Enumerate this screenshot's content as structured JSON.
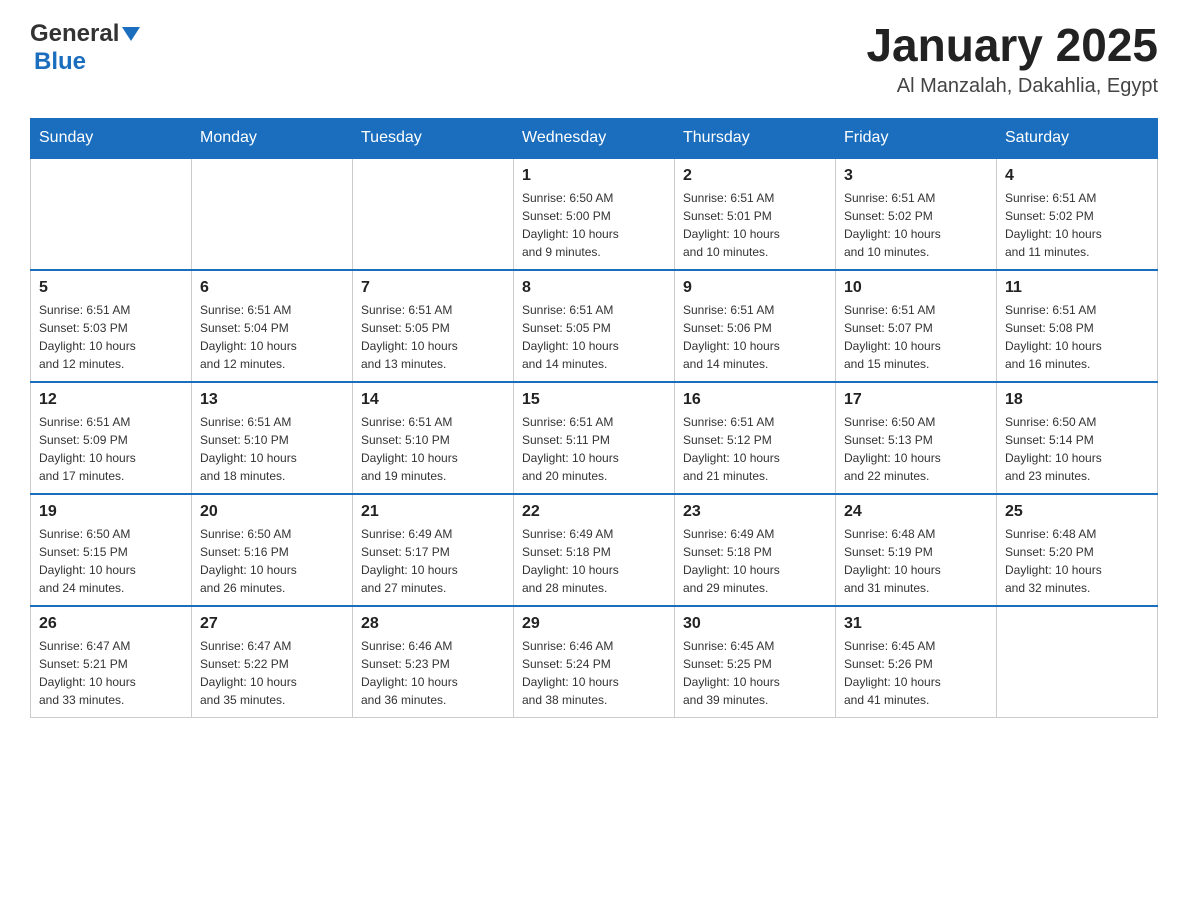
{
  "header": {
    "logo_general": "General",
    "logo_blue": "Blue",
    "title": "January 2025",
    "subtitle": "Al Manzalah, Dakahlia, Egypt"
  },
  "days_of_week": [
    "Sunday",
    "Monday",
    "Tuesday",
    "Wednesday",
    "Thursday",
    "Friday",
    "Saturday"
  ],
  "weeks": [
    [
      {
        "num": "",
        "info": ""
      },
      {
        "num": "",
        "info": ""
      },
      {
        "num": "",
        "info": ""
      },
      {
        "num": "1",
        "info": "Sunrise: 6:50 AM\nSunset: 5:00 PM\nDaylight: 10 hours\nand 9 minutes."
      },
      {
        "num": "2",
        "info": "Sunrise: 6:51 AM\nSunset: 5:01 PM\nDaylight: 10 hours\nand 10 minutes."
      },
      {
        "num": "3",
        "info": "Sunrise: 6:51 AM\nSunset: 5:02 PM\nDaylight: 10 hours\nand 10 minutes."
      },
      {
        "num": "4",
        "info": "Sunrise: 6:51 AM\nSunset: 5:02 PM\nDaylight: 10 hours\nand 11 minutes."
      }
    ],
    [
      {
        "num": "5",
        "info": "Sunrise: 6:51 AM\nSunset: 5:03 PM\nDaylight: 10 hours\nand 12 minutes."
      },
      {
        "num": "6",
        "info": "Sunrise: 6:51 AM\nSunset: 5:04 PM\nDaylight: 10 hours\nand 12 minutes."
      },
      {
        "num": "7",
        "info": "Sunrise: 6:51 AM\nSunset: 5:05 PM\nDaylight: 10 hours\nand 13 minutes."
      },
      {
        "num": "8",
        "info": "Sunrise: 6:51 AM\nSunset: 5:05 PM\nDaylight: 10 hours\nand 14 minutes."
      },
      {
        "num": "9",
        "info": "Sunrise: 6:51 AM\nSunset: 5:06 PM\nDaylight: 10 hours\nand 14 minutes."
      },
      {
        "num": "10",
        "info": "Sunrise: 6:51 AM\nSunset: 5:07 PM\nDaylight: 10 hours\nand 15 minutes."
      },
      {
        "num": "11",
        "info": "Sunrise: 6:51 AM\nSunset: 5:08 PM\nDaylight: 10 hours\nand 16 minutes."
      }
    ],
    [
      {
        "num": "12",
        "info": "Sunrise: 6:51 AM\nSunset: 5:09 PM\nDaylight: 10 hours\nand 17 minutes."
      },
      {
        "num": "13",
        "info": "Sunrise: 6:51 AM\nSunset: 5:10 PM\nDaylight: 10 hours\nand 18 minutes."
      },
      {
        "num": "14",
        "info": "Sunrise: 6:51 AM\nSunset: 5:10 PM\nDaylight: 10 hours\nand 19 minutes."
      },
      {
        "num": "15",
        "info": "Sunrise: 6:51 AM\nSunset: 5:11 PM\nDaylight: 10 hours\nand 20 minutes."
      },
      {
        "num": "16",
        "info": "Sunrise: 6:51 AM\nSunset: 5:12 PM\nDaylight: 10 hours\nand 21 minutes."
      },
      {
        "num": "17",
        "info": "Sunrise: 6:50 AM\nSunset: 5:13 PM\nDaylight: 10 hours\nand 22 minutes."
      },
      {
        "num": "18",
        "info": "Sunrise: 6:50 AM\nSunset: 5:14 PM\nDaylight: 10 hours\nand 23 minutes."
      }
    ],
    [
      {
        "num": "19",
        "info": "Sunrise: 6:50 AM\nSunset: 5:15 PM\nDaylight: 10 hours\nand 24 minutes."
      },
      {
        "num": "20",
        "info": "Sunrise: 6:50 AM\nSunset: 5:16 PM\nDaylight: 10 hours\nand 26 minutes."
      },
      {
        "num": "21",
        "info": "Sunrise: 6:49 AM\nSunset: 5:17 PM\nDaylight: 10 hours\nand 27 minutes."
      },
      {
        "num": "22",
        "info": "Sunrise: 6:49 AM\nSunset: 5:18 PM\nDaylight: 10 hours\nand 28 minutes."
      },
      {
        "num": "23",
        "info": "Sunrise: 6:49 AM\nSunset: 5:18 PM\nDaylight: 10 hours\nand 29 minutes."
      },
      {
        "num": "24",
        "info": "Sunrise: 6:48 AM\nSunset: 5:19 PM\nDaylight: 10 hours\nand 31 minutes."
      },
      {
        "num": "25",
        "info": "Sunrise: 6:48 AM\nSunset: 5:20 PM\nDaylight: 10 hours\nand 32 minutes."
      }
    ],
    [
      {
        "num": "26",
        "info": "Sunrise: 6:47 AM\nSunset: 5:21 PM\nDaylight: 10 hours\nand 33 minutes."
      },
      {
        "num": "27",
        "info": "Sunrise: 6:47 AM\nSunset: 5:22 PM\nDaylight: 10 hours\nand 35 minutes."
      },
      {
        "num": "28",
        "info": "Sunrise: 6:46 AM\nSunset: 5:23 PM\nDaylight: 10 hours\nand 36 minutes."
      },
      {
        "num": "29",
        "info": "Sunrise: 6:46 AM\nSunset: 5:24 PM\nDaylight: 10 hours\nand 38 minutes."
      },
      {
        "num": "30",
        "info": "Sunrise: 6:45 AM\nSunset: 5:25 PM\nDaylight: 10 hours\nand 39 minutes."
      },
      {
        "num": "31",
        "info": "Sunrise: 6:45 AM\nSunset: 5:26 PM\nDaylight: 10 hours\nand 41 minutes."
      },
      {
        "num": "",
        "info": ""
      }
    ]
  ]
}
